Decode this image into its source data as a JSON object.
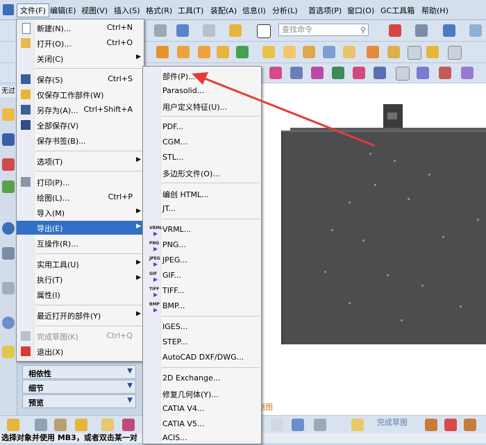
{
  "menubar": {
    "items": [
      "文件(F)",
      "编辑(E)",
      "视图(V)",
      "插入(S)",
      "格式(R)",
      "工具(T)",
      "装配(A)",
      "信息(I)",
      "分析(L)",
      "首选项(P)",
      "窗口(O)",
      "GC工具箱",
      "帮助(H)"
    ]
  },
  "search": {
    "placeholder": "查找命令"
  },
  "file_menu": {
    "items": [
      {
        "label": "新建(N)...",
        "shortcut": "Ctrl+N",
        "icon": "new-file-icon"
      },
      {
        "label": "打开(O)...",
        "shortcut": "Ctrl+O",
        "icon": "open-folder-icon"
      },
      {
        "label": "关闭(C)",
        "submenu": true
      },
      {
        "label": "保存(S)",
        "shortcut": "Ctrl+S",
        "icon": "save-icon"
      },
      {
        "label": "仅保存工作部件(W)",
        "icon": "save-work-part-icon"
      },
      {
        "label": "另存为(A)...",
        "shortcut": "Ctrl+Shift+A",
        "icon": "save-as-icon"
      },
      {
        "label": "全部保存(V)",
        "icon": "save-all-icon"
      },
      {
        "label": "保存书签(B)..."
      },
      {
        "label": "选项(T)",
        "submenu": true
      },
      {
        "label": "打印(P)...",
        "icon": "print-icon"
      },
      {
        "label": "绘图(L)...",
        "shortcut": "Ctrl+P"
      },
      {
        "label": "导入(M)",
        "submenu": true
      },
      {
        "label": "导出(E)",
        "submenu": true,
        "highlighted": true
      },
      {
        "label": "互操作(R)..."
      },
      {
        "label": "实用工具(U)",
        "submenu": true
      },
      {
        "label": "执行(T)",
        "submenu": true
      },
      {
        "label": "属性(I)"
      },
      {
        "label": "最近打开的部件(Y)",
        "submenu": true
      },
      {
        "label": "完成草图(K)",
        "shortcut": "Ctrl+Q",
        "disabled": true,
        "icon": "finish-sketch-icon"
      },
      {
        "label": "退出(X)",
        "icon": "exit-icon"
      }
    ]
  },
  "export_menu": {
    "items": [
      {
        "label": "部件(P)..."
      },
      {
        "label": "Parasolid..."
      },
      {
        "label": "用户定义特征(U)..."
      },
      {
        "label": "PDF..."
      },
      {
        "label": "CGM..."
      },
      {
        "label": "STL..."
      },
      {
        "label": "多边形文件(O)..."
      },
      {
        "label": "编创 HTML..."
      },
      {
        "label": "JT..."
      },
      {
        "label": "VRML...",
        "format": "VRML"
      },
      {
        "label": "PNG...",
        "format": "PNG"
      },
      {
        "label": "JPEG...",
        "format": "JPEG"
      },
      {
        "label": "GIF...",
        "format": "GIF"
      },
      {
        "label": "TIFF...",
        "format": "TIFF"
      },
      {
        "label": "BMP...",
        "format": "BMP"
      },
      {
        "label": "IGES..."
      },
      {
        "label": "STEP..."
      },
      {
        "label": "AutoCAD DXF/DWG..."
      },
      {
        "label": "2D Exchange..."
      },
      {
        "label": "修复几何体(Y)..."
      },
      {
        "label": "CATIA V4..."
      },
      {
        "label": "CATIA V5..."
      },
      {
        "label": "ACIS..."
      }
    ]
  },
  "nav_panels": [
    "相依性",
    "细节",
    "预览"
  ],
  "left_label": "无过",
  "status": {
    "text": "选择对象并使用 MB3，或者双击某一对"
  },
  "watermark": "完成草图",
  "measure_label": "测图",
  "colors": {
    "highlight": "#3170c4",
    "arrow": "#e53b3b",
    "model": "#4d4d4f"
  }
}
